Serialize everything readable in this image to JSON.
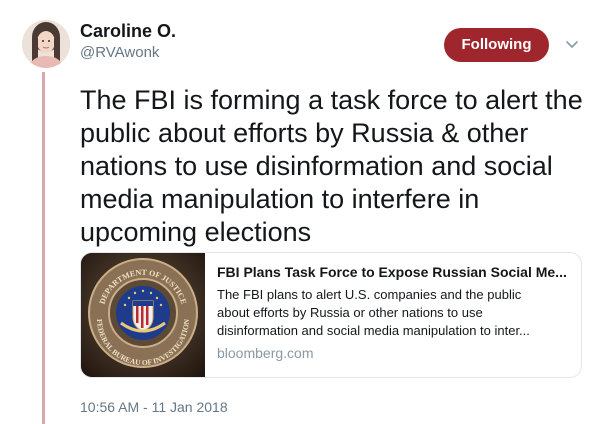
{
  "author": {
    "name": "Caroline O.",
    "handle": "@RVAwonk",
    "avatar_icon": "profile-photo"
  },
  "follow_button": {
    "label": "Following",
    "color": "#a0262d"
  },
  "menu_icon": "chevron-down-icon",
  "tweet": {
    "text": "The FBI is forming a task force to alert the public about efforts by Russia & other nations to use disinformation and social media manipulation to interfere in upcoming elections",
    "timestamp": "10:56 AM - 11 Jan 2018"
  },
  "card": {
    "title": "FBI Plans Task Force to Expose Russian Social Me...",
    "description_lines": [
      "The FBI plans to alert U.S. companies and the public",
      "about efforts by Russia or other nations to use",
      "disinformation and social media manipulation to inter..."
    ],
    "domain": "bloomberg.com",
    "image": {
      "seal_top_text": "DEPARTMENT OF JUSTICE",
      "seal_bottom_text": "FEDERAL BUREAU OF INVESTIGATION"
    }
  },
  "colors": {
    "thread_line": "#d6a9ac",
    "secondary_text": "#657786",
    "domain_text": "#8899a6"
  }
}
